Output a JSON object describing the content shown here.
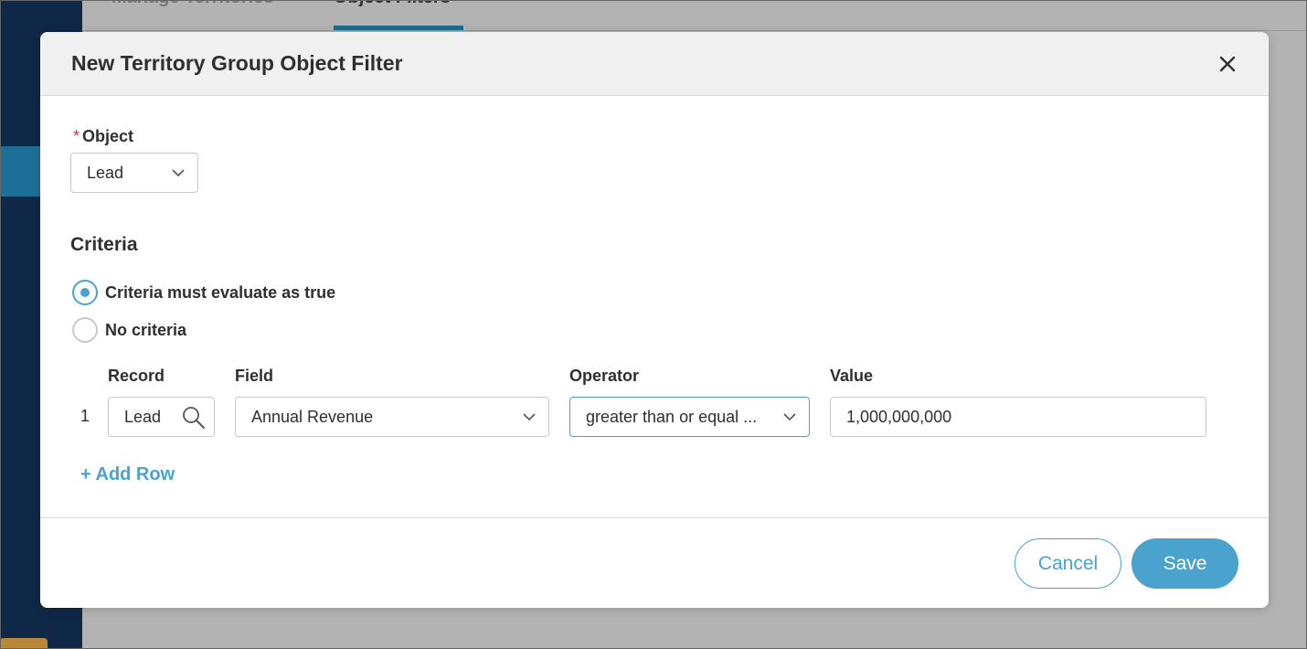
{
  "background": {
    "tabs": [
      "Manage Territories",
      "Object Filters"
    ]
  },
  "modal": {
    "title": "New Territory Group Object Filter",
    "close_icon": "close-icon"
  },
  "object": {
    "required_marker": "*",
    "label": "Object",
    "value": "Lead"
  },
  "criteria": {
    "heading": "Criteria",
    "options": [
      {
        "label": "Criteria must evaluate as true",
        "selected": true
      },
      {
        "label": "No criteria",
        "selected": false
      }
    ],
    "columns": {
      "record": "Record",
      "field": "Field",
      "operator": "Operator",
      "value": "Value"
    },
    "rows": [
      {
        "number": "1",
        "record": "Lead",
        "field": "Annual Revenue",
        "operator": "greater than or equal ...",
        "value": "1,000,000,000"
      }
    ],
    "add_row_label": "+ Add Row"
  },
  "footer": {
    "cancel_label": "Cancel",
    "save_label": "Save"
  },
  "colors": {
    "accent": "#4aa3cf",
    "sidebar": "#0f2848",
    "required": "#c23934"
  }
}
